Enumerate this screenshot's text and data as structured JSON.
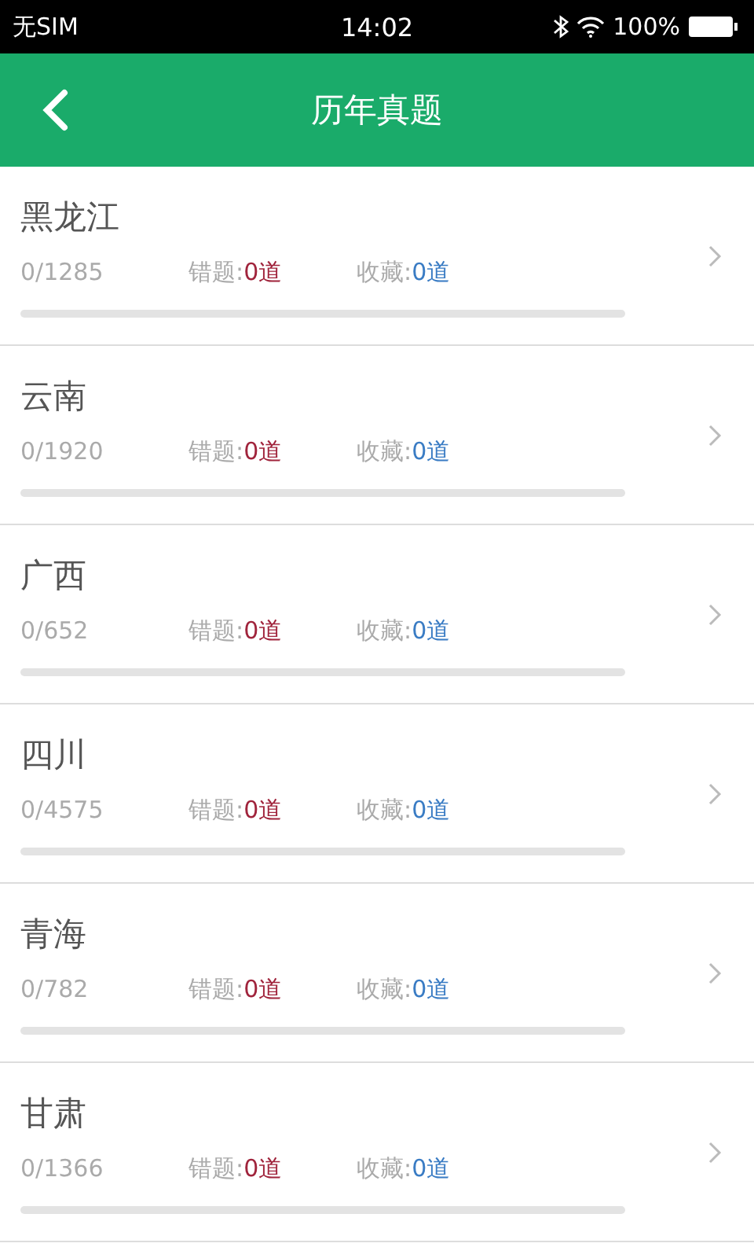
{
  "status_bar": {
    "carrier": "无SIM",
    "time": "14:02",
    "battery": "100%"
  },
  "header": {
    "title": "历年真题"
  },
  "rows": [
    {
      "name": "黑龙江",
      "progress": "0/1285",
      "level": 0,
      "wrong_label": "错题:",
      "wrong_value": "0道",
      "fav_label": "收藏:",
      "fav_value": "0道"
    },
    {
      "name": "云南",
      "progress": "0/1920",
      "level": 0,
      "wrong_label": "错题:",
      "wrong_value": "0道",
      "fav_label": "收藏:",
      "fav_value": "0道"
    },
    {
      "name": "广西",
      "progress": "0/652",
      "level": 0,
      "wrong_label": "错题:",
      "wrong_value": "0道",
      "fav_label": "收藏:",
      "fav_value": "0道"
    },
    {
      "name": "四川",
      "progress": "0/4575",
      "level": 0,
      "wrong_label": "错题:",
      "wrong_value": "0道",
      "fav_label": "收藏:",
      "fav_value": "0道"
    },
    {
      "name": "青海",
      "progress": "0/782",
      "level": 0,
      "wrong_label": "错题:",
      "wrong_value": "0道",
      "fav_label": "收藏:",
      "fav_value": "0道"
    },
    {
      "name": "甘肃",
      "progress": "0/1366",
      "level": 0,
      "wrong_label": "错题:",
      "wrong_value": "0道",
      "fav_label": "收藏:",
      "fav_value": "0道"
    }
  ]
}
